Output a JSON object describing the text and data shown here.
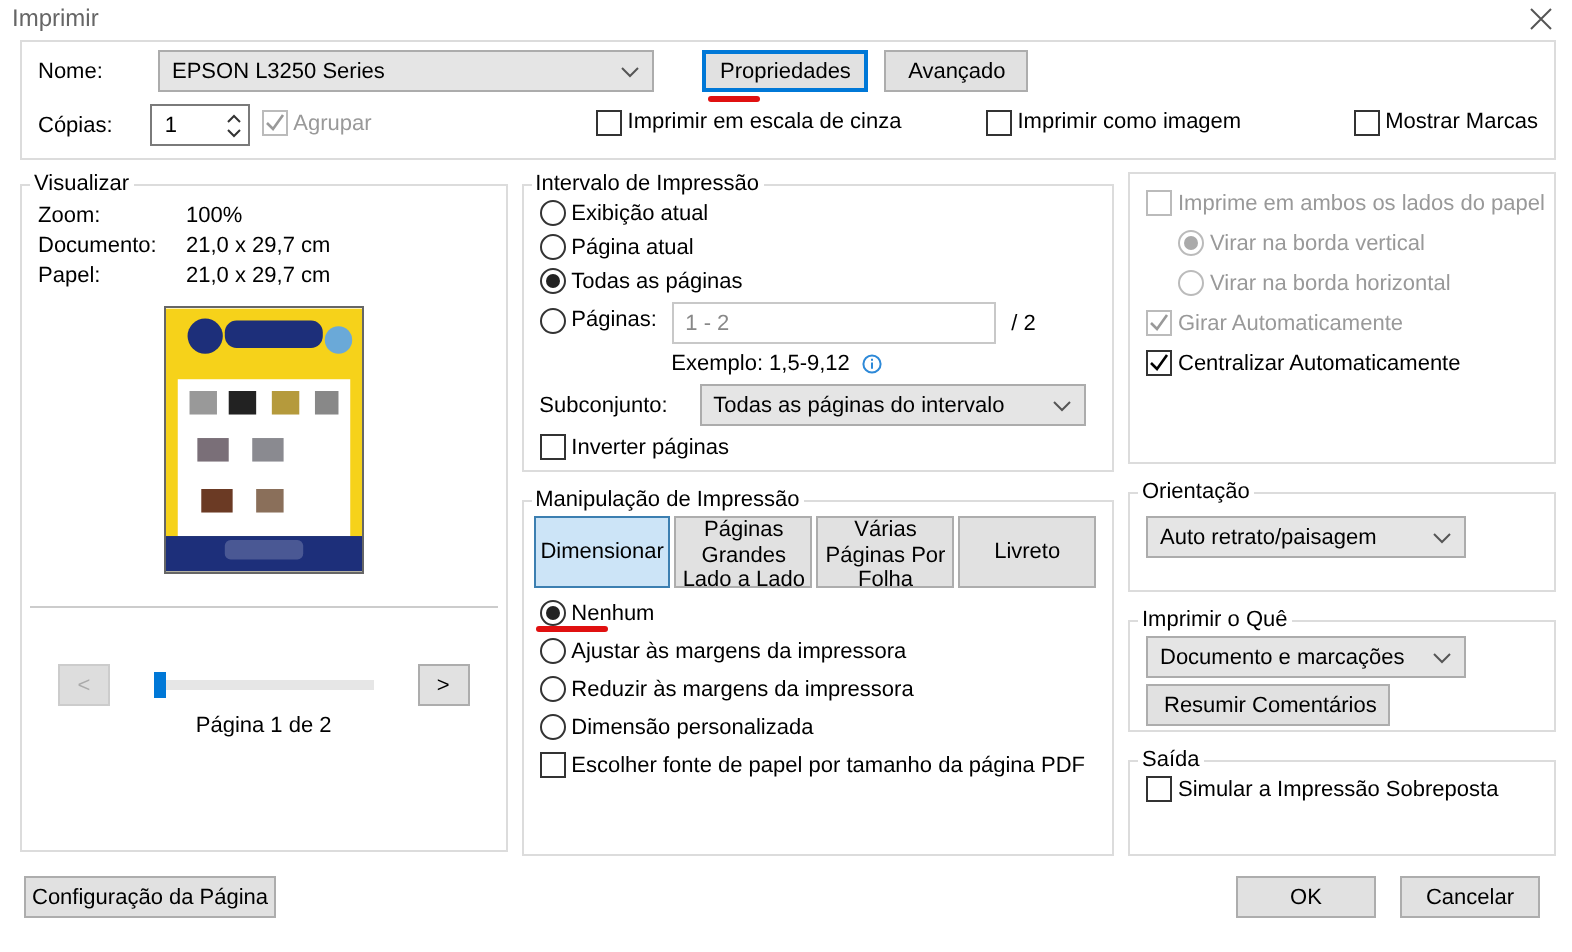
{
  "window": {
    "title": "Imprimir"
  },
  "printer": {
    "name_label": "Nome:",
    "name": "EPSON L3250 Series",
    "properties_button": "Propriedades",
    "properties_annotated": true,
    "advanced_button": "Avançado",
    "copies_label": "Cópias:",
    "copies": "1",
    "options": [
      {
        "label": "Agrupar",
        "checked": true,
        "disabled": true
      },
      {
        "label": "Imprimir em escala de cinza",
        "checked": false,
        "disabled": false
      },
      {
        "label": "Imprimir como imagem",
        "checked": false,
        "disabled": false
      },
      {
        "label": "Mostrar Marcas",
        "checked": false,
        "disabled": false
      }
    ]
  },
  "preview": {
    "title": "Visualizar",
    "info": [
      {
        "label": "Zoom:",
        "value": "100%"
      },
      {
        "label": "Documento:",
        "value": "21,0 x 29,7 cm"
      },
      {
        "label": "Papel:",
        "value": "21,0 x 29,7 cm"
      }
    ],
    "prev_button": "<",
    "prev_disabled": true,
    "next_button": ">",
    "level": 0,
    "page_label": "Página 1 de 2"
  },
  "range": {
    "title": "Intervalo de Impressão",
    "options": [
      {
        "label": "Exibição atual",
        "selected": false
      },
      {
        "label": "Página atual",
        "selected": false
      },
      {
        "label": "Todas as páginas",
        "selected": true
      },
      {
        "label": "Páginas:",
        "selected": false
      }
    ],
    "pages_value": "1 - 2",
    "pages_total": "/ 2",
    "example": "Exemplo: 1,5-9,12",
    "subset_label": "Subconjunto:",
    "subset": "Todas as páginas do intervalo",
    "reverse": {
      "label": "Inverter páginas",
      "checked": false
    }
  },
  "handling": {
    "title": "Manipulação de Impressão",
    "tabs": [
      {
        "label": "Dimensionar",
        "selected": true
      },
      {
        "label": "Páginas Grandes Lado a Lado",
        "selected": false
      },
      {
        "label": "Várias Páginas Por Folha",
        "selected": false
      },
      {
        "label": "Livreto",
        "selected": false
      }
    ],
    "options": [
      {
        "label": "Nenhum",
        "selected": true,
        "annotated": true
      },
      {
        "label": "Ajustar às margens da impressora",
        "selected": false,
        "annotated": false
      },
      {
        "label": "Reduzir às margens da impressora",
        "selected": false,
        "annotated": false
      },
      {
        "label": "Dimensão personalizada",
        "selected": false,
        "annotated": false
      }
    ],
    "paper_source": {
      "label": "Escolher fonte de papel por tamanho da página PDF",
      "checked": false
    }
  },
  "duplex": {
    "items": [
      {
        "kind": "checkbox",
        "label": "Imprime em ambos os lados do papel",
        "checked": false,
        "disabled": true,
        "children": [
          {
            "kind": "radio",
            "label": "Virar na borda vertical",
            "selected": true,
            "disabled": true
          },
          {
            "kind": "radio",
            "label": "Virar na borda horizontal",
            "selected": false,
            "disabled": true
          }
        ]
      },
      {
        "kind": "checkbox",
        "label": "Girar Automaticamente",
        "checked": true,
        "disabled": true
      },
      {
        "kind": "checkbox",
        "label": "Centralizar Automaticamente",
        "checked": true,
        "disabled": false
      }
    ]
  },
  "orientation": {
    "title": "Orientação",
    "value": "Auto retrato/paisagem"
  },
  "what": {
    "title": "Imprimir o Quê",
    "value": "Documento e marcações",
    "button": "Resumir Comentários"
  },
  "output": {
    "title": "Saída",
    "option": {
      "label": "Simular a Impressão Sobreposta",
      "checked": false
    }
  },
  "footer": {
    "page_setup": "Configuração da Página",
    "ok": "OK",
    "cancel": "Cancelar"
  }
}
